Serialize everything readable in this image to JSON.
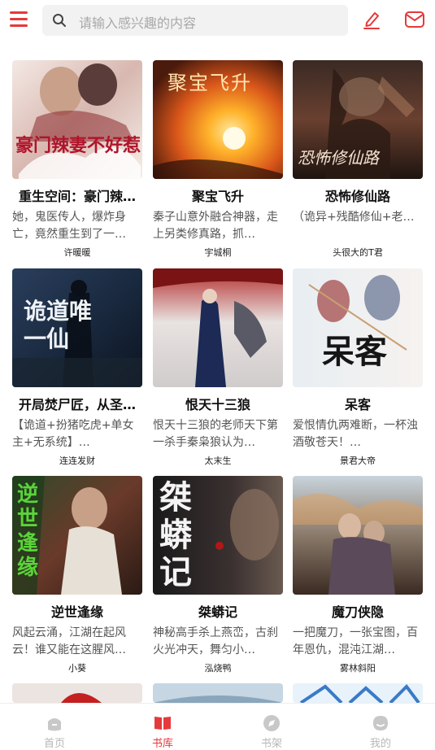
{
  "accent_color": "#e5393b",
  "header": {
    "menu_icon": "menu-icon",
    "search_placeholder": "请输入感兴趣的内容",
    "edit_icon": "edit-icon",
    "mail_icon": "mail-icon"
  },
  "books": [
    {
      "cover_title": "豪门辣妻不好惹",
      "title": "重生空间：豪门辣…",
      "desc": "她，鬼医传人，爆炸身亡，竟然重生到了一…",
      "author": "许暖暖"
    },
    {
      "cover_title": "聚宝飞升",
      "title": "聚宝飞升",
      "desc": "秦子山意外融合神器，走上另类修真路，抓…",
      "author": "宇城桐"
    },
    {
      "cover_title": "恐怖修仙路",
      "title": "恐怖修仙路",
      "desc": "（诡异+残酷修仙+老…",
      "author": "头很大的T君"
    },
    {
      "cover_title": "诡道唯一仙",
      "title": "开局焚尸匠，从圣…",
      "desc": "【诡道+扮猪吃虎+单女主+无系统】…",
      "author": "连连发财"
    },
    {
      "cover_title": "",
      "title": "恨天十三狼",
      "desc": "恨天十三狼的老师天下第一杀手秦枭狼认为…",
      "author": "太末生"
    },
    {
      "cover_title": "呆客",
      "title": "呆客",
      "desc": "爱恨情仇两难断，一杯浊酒敬苍天！…",
      "author": "景君大帝"
    },
    {
      "cover_title": "逆世逢缘",
      "title": "逆世逢缘",
      "desc": "风起云涌，江湖在起风云！谁又能在这腥风…",
      "author": "小葵"
    },
    {
      "cover_title": "桀蟒记",
      "title": "桀蟒记",
      "desc": "神秘高手杀上燕峦，古刹火光冲天，舞匀小…",
      "author": "泓烧鸭"
    },
    {
      "cover_title": "",
      "title": "魔刀侠隐",
      "desc": "一把魔刀，一张宝图，百年恩仇，混沌江湖…",
      "author": "雾林斜阳"
    }
  ],
  "tabs": [
    {
      "label": "首页",
      "icon": "home-icon",
      "active": false
    },
    {
      "label": "书库",
      "icon": "library-icon",
      "active": true
    },
    {
      "label": "书架",
      "icon": "bookshelf-icon",
      "active": false
    },
    {
      "label": "我的",
      "icon": "profile-icon",
      "active": false
    }
  ]
}
